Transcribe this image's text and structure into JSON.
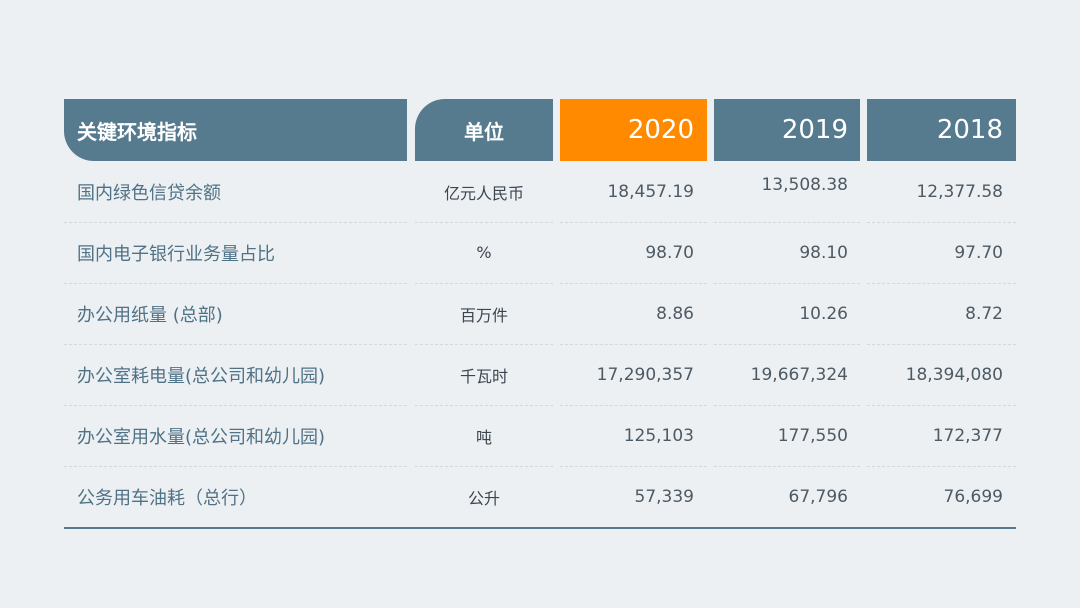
{
  "table": {
    "headers": {
      "indicator": "关键环境指标",
      "unit": "单位",
      "y2020": "2020",
      "y2019": "2019",
      "y2018": "2018"
    },
    "header_colors": {
      "default": "#567a8e",
      "highlight": "#ff8a00"
    },
    "rows": [
      {
        "name": "国内绿色信贷余额",
        "unit": "亿元人民币",
        "v2020": "18,457.19",
        "v2019": "13,508.38",
        "v2018": "12,377.58"
      },
      {
        "name": "国内电子银行业务量占比",
        "unit": "%",
        "v2020": "98.70",
        "v2019": "98.10",
        "v2018": "97.70"
      },
      {
        "name": "办公用纸量 (总部)",
        "unit": "百万件",
        "v2020": "8.86",
        "v2019": "10.26",
        "v2018": "8.72"
      },
      {
        "name": "办公室耗电量(总公司和幼儿园)",
        "unit": "千瓦时",
        "v2020": "17,290,357",
        "v2019": "19,667,324",
        "v2018": "18,394,080"
      },
      {
        "name": "办公室用水量(总公司和幼儿园)",
        "unit": "吨",
        "v2020": "125,103",
        "v2019": "177,550",
        "v2018": "172,377"
      },
      {
        "name": "公务用车油耗（总行）",
        "unit": "公升",
        "v2020": "57,339",
        "v2019": "67,796",
        "v2018": "76,699"
      }
    ]
  }
}
